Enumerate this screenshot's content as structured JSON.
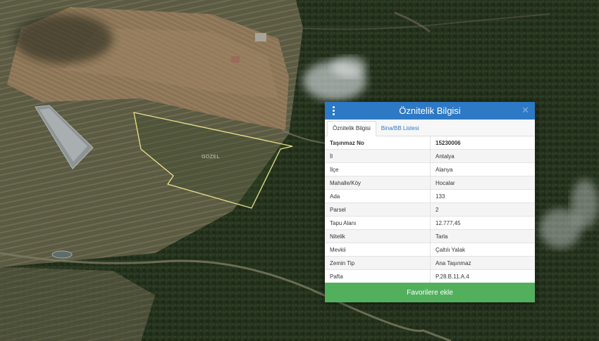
{
  "map": {
    "parcel_label": "GOZEL"
  },
  "panel": {
    "title": "Öznitelik Bilgisi",
    "menu_icon": "vertical-dots-icon",
    "close_icon": "close-icon",
    "tabs": [
      {
        "label": "Öznitelik Bilgisi",
        "active": true
      },
      {
        "label": "Bina/BB Listesi",
        "active": false
      }
    ],
    "rows": [
      {
        "key": "Taşınmaz No",
        "value": "15230006"
      },
      {
        "key": "İl",
        "value": "Antalya"
      },
      {
        "key": "İlçe",
        "value": "Alanya"
      },
      {
        "key": "Mahalle/Köy",
        "value": "Hocalar"
      },
      {
        "key": "Ada",
        "value": "133"
      },
      {
        "key": "Parsel",
        "value": "2"
      },
      {
        "key": "Tapu Alanı",
        "value": "12.777,45"
      },
      {
        "key": "Nitelik",
        "value": "Tarla"
      },
      {
        "key": "Mevkii",
        "value": "Çaltılı Yalak"
      },
      {
        "key": "Zemin Tip",
        "value": "Ana Taşınmaz"
      },
      {
        "key": "Pafta",
        "value": "P.28.B.11.A.4"
      }
    ],
    "favorite_label": "Favorilere ekle"
  },
  "colors": {
    "header": "#2d79c6",
    "favorite": "#52b05d",
    "parcel_outline": "#e9e38a"
  }
}
